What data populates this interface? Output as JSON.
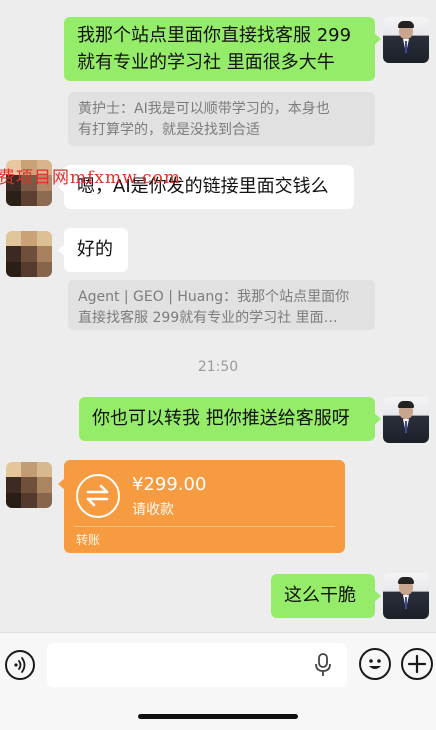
{
  "messages": {
    "m1": "我那个站点里面你直接找客服 299\n就有专业的学习社 里面很多大牛",
    "q1": "黄护士：AI我是可以顺带学习的，本身也\n有打算学的，就是没找到合适",
    "m2": "嗯，AI是你发的链接里面交钱么",
    "m3": "好的",
    "q2": "Agent | GEO | Huang：我那个站点里面你\n直接找客服 299就有专业的学习社 里面…",
    "time": "21:50",
    "m4": "你也可以转我 把你推送给客服呀",
    "m6": "这么干脆"
  },
  "transfer": {
    "amount": "¥299.00",
    "status": "请收款",
    "footer": "转账"
  },
  "watermark": "费项目网mfxmw.com",
  "input": {
    "placeholder": ""
  },
  "icons": {
    "voice": "voice-icon",
    "mic": "microphone-icon",
    "emoji": "emoji-icon",
    "plus": "plus-icon",
    "transfer": "transfer-icon"
  },
  "colors": {
    "my_bubble": "#95ec69",
    "their_bubble": "#ffffff",
    "transfer_card": "#f79b41",
    "background": "#ededed"
  }
}
